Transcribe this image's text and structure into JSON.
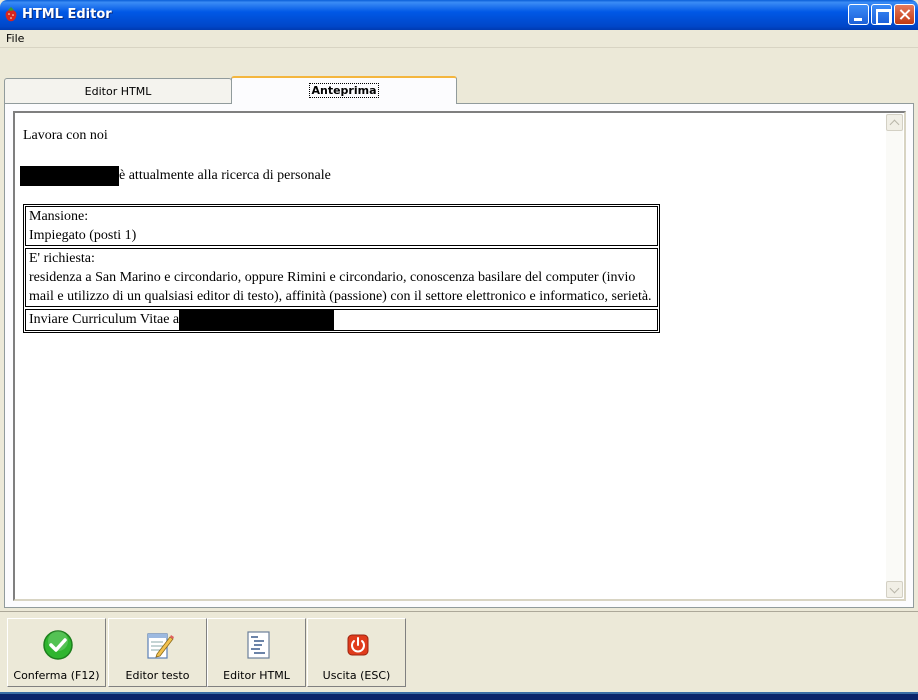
{
  "window": {
    "title": "HTML Editor",
    "icon": "strawberry-icon"
  },
  "menu": {
    "file": "File"
  },
  "tabs": [
    {
      "label": "Editor HTML",
      "active": false
    },
    {
      "label": "Anteprima",
      "active": true
    }
  ],
  "preview": {
    "heading": "Lavora con noi",
    "intro_text": "è attualmente alla ricerca di personale",
    "table": {
      "mansione_label": "Mansione:",
      "mansione_value": "Impiegato (posti 1)",
      "richiesta_label": "E' richiesta:",
      "richiesta_value": "residenza a San Marino e circondario, oppure Rimini e circondario, conoscenza basilare del computer (invio mail e utilizzo di un qualsiasi editor di testo), affinità (passione) con il settore elettronico e informatico, serietà.",
      "cv_text": "Inviare Curriculum Vitae a"
    }
  },
  "toolbar": {
    "confirm": {
      "label": "Conferma (F12)",
      "icon": "check-icon",
      "color": "#2fb52f"
    },
    "text_editor": {
      "label": "Editor testo",
      "icon": "notepad-pencil-icon"
    },
    "html_editor": {
      "label": "Editor HTML",
      "icon": "html-document-icon"
    },
    "exit": {
      "label": "Uscita (ESC)",
      "icon": "power-icon",
      "color": "#e03c1c"
    }
  },
  "colors": {
    "titlebar": "#0058e6",
    "window_bg": "#ece9d8",
    "active_tab_accent": "#f4b63e"
  }
}
